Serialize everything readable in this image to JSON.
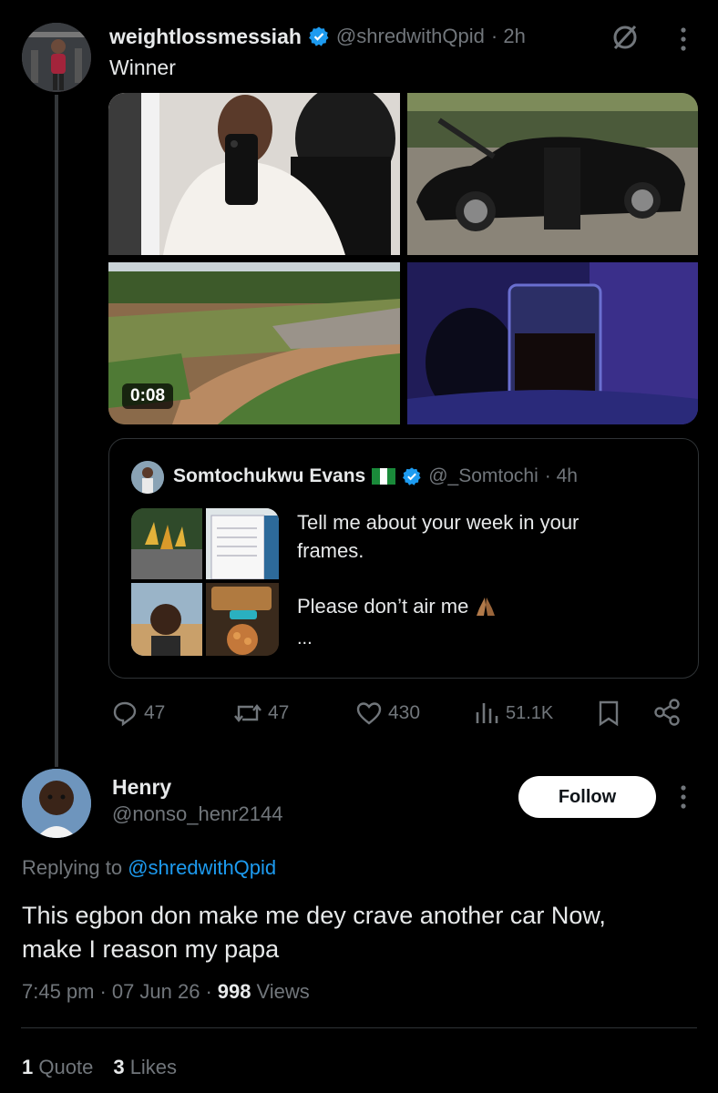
{
  "colors": {
    "accent": "#1d9bf0",
    "muted": "#71767b",
    "text": "#e7e9ea",
    "bg": "#000000"
  },
  "post": {
    "author_name": "weightlossmessiah",
    "handle": "@shredwithQpid",
    "time": "· 2h",
    "text": "Winner",
    "video_duration": "0:08",
    "stats": {
      "replies": "47",
      "reposts": "47",
      "likes": "430",
      "views": "51.1K"
    }
  },
  "quoted": {
    "author_name": "Somtochukwu Evans",
    "handle": "@_Somtochi",
    "time": "· 4h",
    "line1": "Tell me about your week in your",
    "line2": "frames.",
    "line3": "Please don’t air me",
    "ellipsis": "..."
  },
  "reply": {
    "author_name": "Henry",
    "handle": "@nonso_henr2144",
    "follow_label": "Follow",
    "replying_prefix": "Replying to ",
    "replying_handle": "@shredwithQpid",
    "text_line1": "This egbon don make me dey crave another car Now,",
    "text_line2": "make I reason my papa",
    "time": "7:45 pm",
    "date": "07 Jun 26",
    "views_count": "998",
    "views_label": "Views",
    "quote_count": "1",
    "quote_label": "Quote",
    "likes_count": "3",
    "likes_label": "Likes"
  }
}
